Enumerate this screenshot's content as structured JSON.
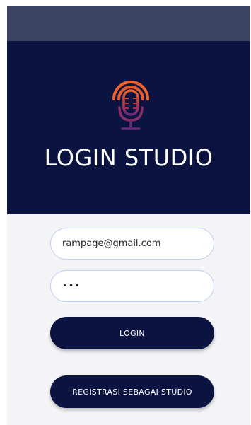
{
  "header": {
    "title": "LOGIN STUDIO"
  },
  "form": {
    "email_value": "rampage@gmail.com",
    "password_value": "•••"
  },
  "buttons": {
    "login_label": "LOGIN",
    "register_label": "REGISTRASI SEBAGAI STUDIO"
  },
  "icons": {
    "logo": "studio-microphone-icon"
  },
  "colors": {
    "primary": "#0b1340",
    "status_bar": "#3b4563",
    "field_border": "#bfd2f0",
    "logo_orange": "#e8562a",
    "logo_purple": "#6a2a7a"
  }
}
